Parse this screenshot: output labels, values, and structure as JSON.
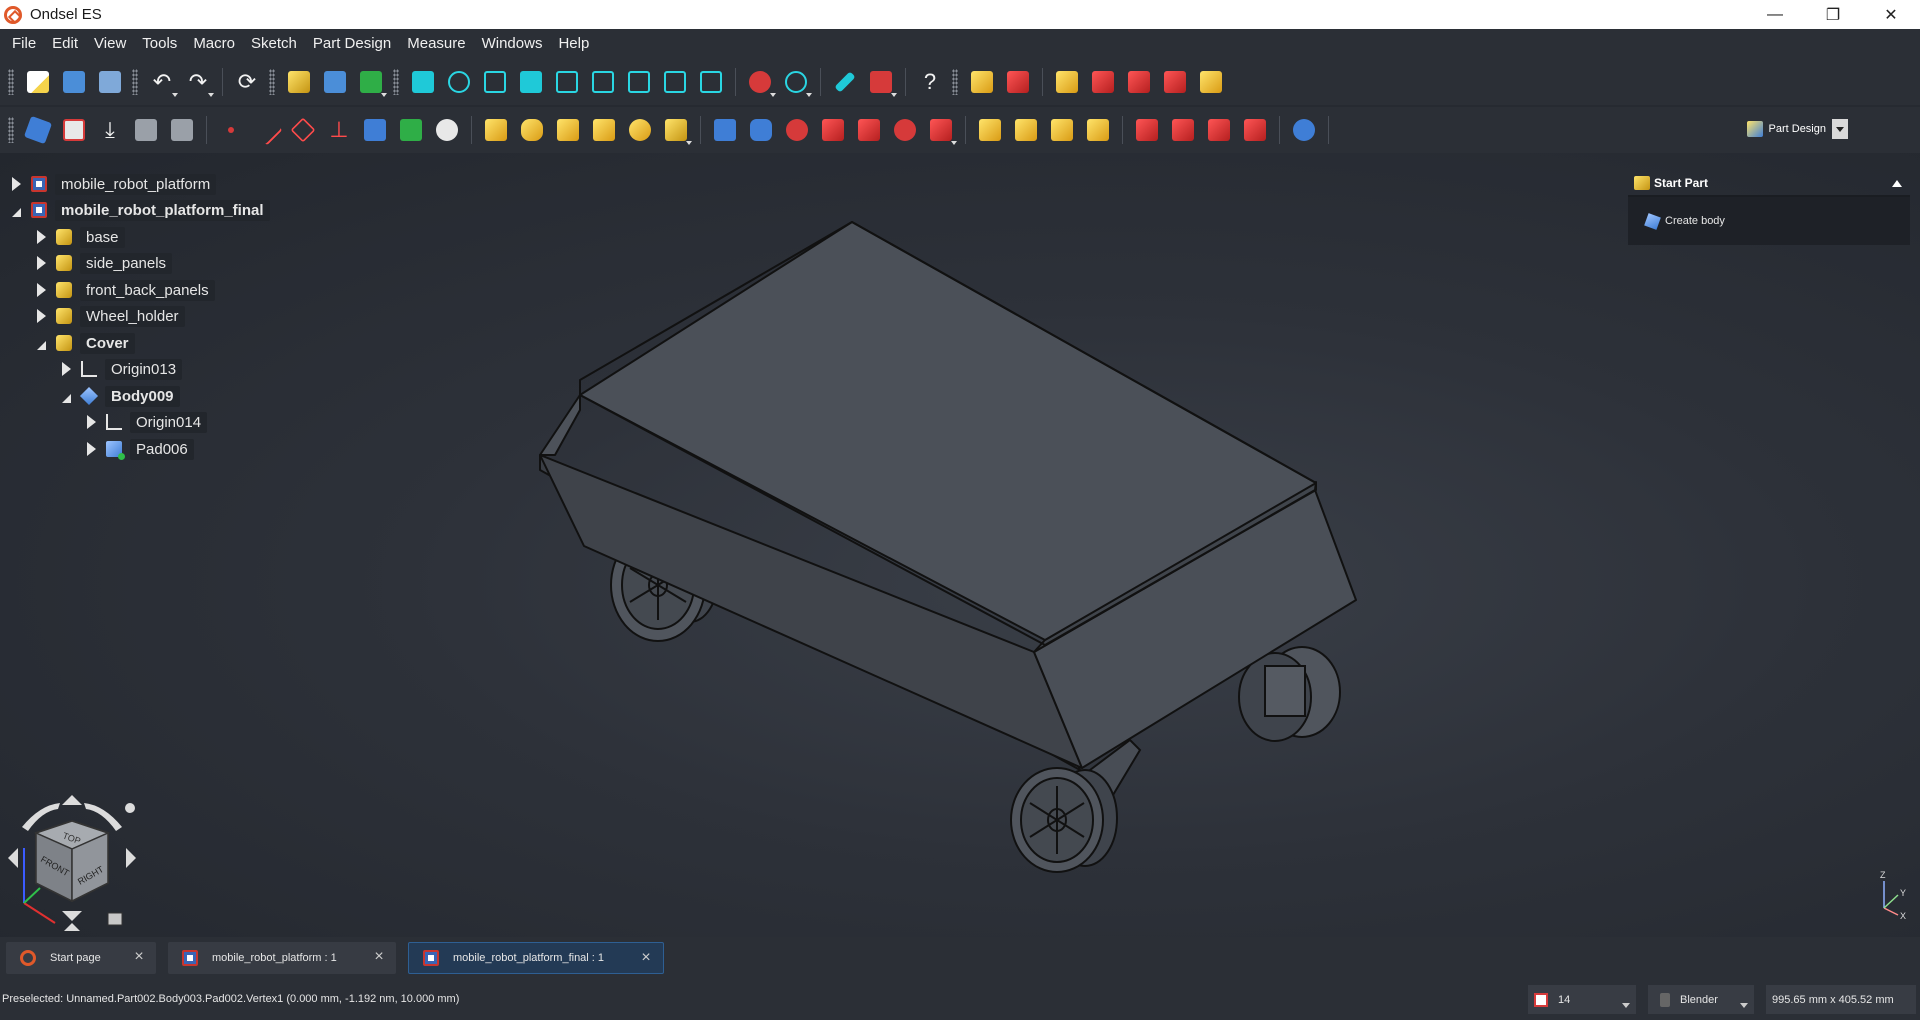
{
  "window": {
    "title": "Ondsel ES",
    "minimize": "—",
    "restore": "❐",
    "close": "✕"
  },
  "menu": [
    "File",
    "Edit",
    "View",
    "Tools",
    "Macro",
    "Sketch",
    "Part Design",
    "Measure",
    "Windows",
    "Help"
  ],
  "workbench": {
    "label": "Part Design"
  },
  "tree": [
    {
      "label": "mobile_robot_platform",
      "icon": "document-icon",
      "state": "closed",
      "bold": false
    },
    {
      "label": "mobile_robot_platform_final",
      "icon": "document-icon",
      "state": "open",
      "bold": true
    },
    {
      "label": "base",
      "icon": "part-icon",
      "state": "closed",
      "bold": false
    },
    {
      "label": "side_panels",
      "icon": "part-icon",
      "state": "closed",
      "bold": false
    },
    {
      "label": "front_back_panels",
      "icon": "part-icon",
      "state": "closed",
      "bold": false
    },
    {
      "label": "Wheel_holder",
      "icon": "part-icon",
      "state": "closed",
      "bold": false
    },
    {
      "label": "Cover",
      "icon": "part-icon",
      "state": "open",
      "bold": true
    },
    {
      "label": "Origin013",
      "icon": "origin-icon",
      "state": "closed",
      "bold": false
    },
    {
      "label": "Body009",
      "icon": "body-icon",
      "state": "open",
      "bold": true
    },
    {
      "label": "Origin014",
      "icon": "origin-icon",
      "state": "closed",
      "bold": false
    },
    {
      "label": "Pad006",
      "icon": "pad-icon",
      "state": "closed",
      "bold": false
    }
  ],
  "task_panel": {
    "header": "Start Part",
    "action": "Create body"
  },
  "navcube": {
    "top": "TOP",
    "front": "FRONT",
    "right": "RIGHT"
  },
  "axis": {
    "z": "Z",
    "y": "Y",
    "x": "X"
  },
  "tabs": [
    {
      "label": "Start page",
      "icon": "ondsel-icon",
      "active": false
    },
    {
      "label": "mobile_robot_platform : 1",
      "icon": "document-icon",
      "active": false
    },
    {
      "label": "mobile_robot_platform_final : 1",
      "icon": "document-icon",
      "active": true
    }
  ],
  "status": {
    "text": "Preselected: Unnamed.Part002.Body003.Pad002.Vertex1 (0.000 mm, -1.192 nm, 10.000 mm)",
    "value_14": "14",
    "nav_style": "Blender",
    "dimensions": "995.65 mm x 405.52 mm"
  },
  "colors": {
    "accent": "#2e5f93",
    "background": "#262a31",
    "model": "#4b5058",
    "edge": "#111111"
  }
}
